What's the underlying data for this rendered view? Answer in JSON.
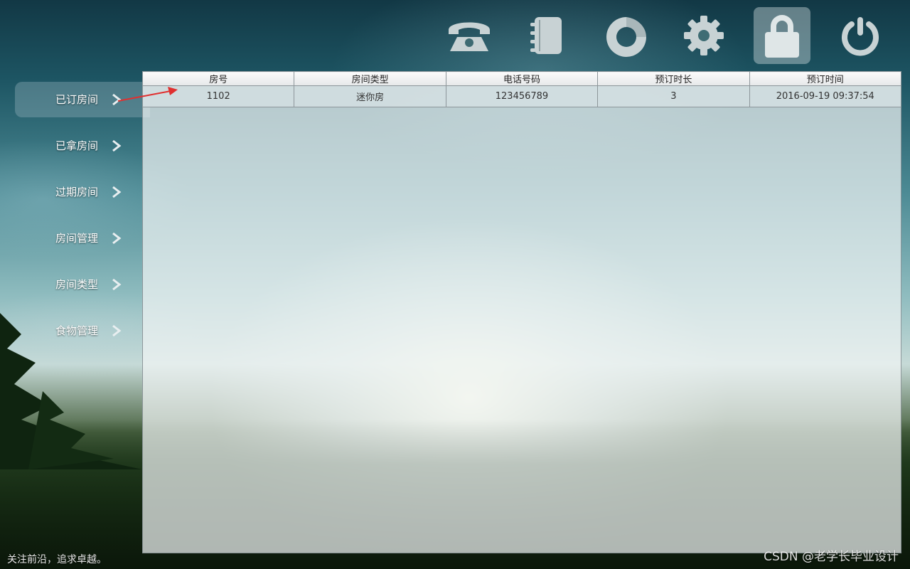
{
  "toolbar": {
    "tools": [
      {
        "icon": "phone-icon"
      },
      {
        "icon": "address-book-icon"
      },
      {
        "icon": "refresh-icon"
      },
      {
        "icon": "settings-gear-icon"
      },
      {
        "icon": "lock-icon",
        "active": true
      },
      {
        "icon": "power-icon"
      }
    ]
  },
  "sidebar": {
    "items": [
      {
        "label": "已订房间",
        "active": true
      },
      {
        "label": "已拿房间"
      },
      {
        "label": "过期房间"
      },
      {
        "label": "房间管理"
      },
      {
        "label": "房间类型"
      },
      {
        "label": "食物管理"
      }
    ]
  },
  "table": {
    "columns": [
      "房号",
      "房间类型",
      "电话号码",
      "预订时长",
      "预订时间"
    ],
    "rows": [
      [
        "1102",
        "迷你房",
        "123456789",
        "3",
        "2016-09-19 09:37:54"
      ]
    ]
  },
  "footer": {
    "slogan": "关注前沿，追求卓越。",
    "watermark": "CSDN @老学长毕业设计"
  },
  "colors": {
    "annotation_arrow": "#e03030",
    "icon_fill": "#c8d2d4"
  }
}
